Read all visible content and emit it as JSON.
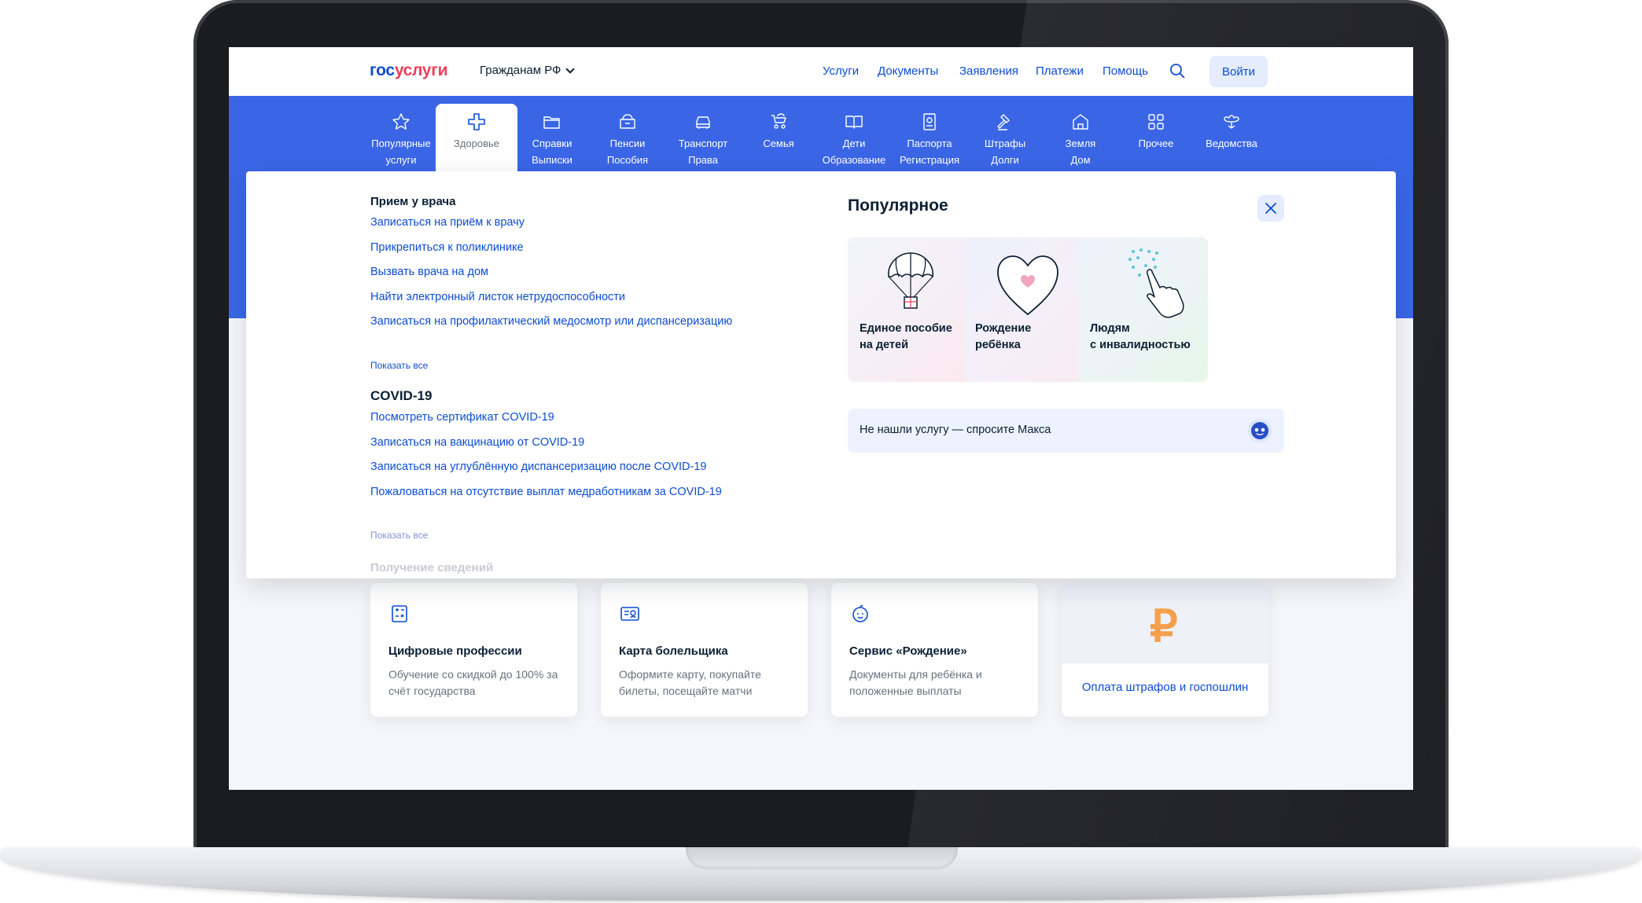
{
  "header": {
    "logo_part1": "гос",
    "logo_part2": "услуги",
    "region": "Гражданам РФ",
    "nav": [
      "Услуги",
      "Документы",
      "Заявления",
      "Платежи",
      "Помощь"
    ],
    "login": "Войти"
  },
  "categories": [
    {
      "l1": "Популярные",
      "l2": "услуги",
      "icon": "star-icon"
    },
    {
      "l1": "Здоровье",
      "l2": "",
      "icon": "medical-cross-icon"
    },
    {
      "l1": "Справки",
      "l2": "Выписки",
      "icon": "folder-icon"
    },
    {
      "l1": "Пенсии",
      "l2": "Пособия",
      "icon": "wallet-icon"
    },
    {
      "l1": "Транспорт",
      "l2": "Права",
      "icon": "car-icon"
    },
    {
      "l1": "Семья",
      "l2": "",
      "icon": "stroller-icon"
    },
    {
      "l1": "Дети",
      "l2": "Образование",
      "icon": "book-icon"
    },
    {
      "l1": "Паспорта",
      "l2": "Регистрация",
      "icon": "passport-icon"
    },
    {
      "l1": "Штрафы",
      "l2": "Долги",
      "icon": "gavel-icon"
    },
    {
      "l1": "Земля",
      "l2": "Дом",
      "icon": "house-icon"
    },
    {
      "l1": "Прочее",
      "l2": "",
      "icon": "grid-icon"
    },
    {
      "l1": "Ведомства",
      "l2": "",
      "icon": "emblem-icon"
    }
  ],
  "dropdown": {
    "sections": [
      {
        "title": "Прием у врача",
        "links": [
          "Записаться на приём к врачу",
          "Прикрепиться к поликлинике",
          "Вызвать врача на дом",
          "Найти электронный листок нетрудоспособности",
          "Записаться на профилактический медосмотр или диспансеризацию"
        ],
        "show_all": "Показать все"
      },
      {
        "title": "COVID-19",
        "links": [
          "Посмотреть сертификат COVID-19",
          "Записаться на вакцинацию от COVID-19",
          "Записаться на углублённую диспансеризацию после COVID-19",
          "Пожаловаться на отсутствие выплат медработникам за COVID-19"
        ],
        "show_all": "Показать все"
      }
    ],
    "next_section": "Получение сведений",
    "popular_title": "Популярное",
    "popular": [
      {
        "line1": "Единое пособие",
        "line2": "на детей",
        "art": "parachute-gift-icon"
      },
      {
        "line1": "Рождение",
        "line2": "ребёнка",
        "art": "heart-icon"
      },
      {
        "line1": "Людям",
        "line2": "с инвалидностью",
        "art": "braille-hand-icon"
      }
    ],
    "ask": "Не нашли услугу — спросите Макса"
  },
  "cards": [
    {
      "title": "Цифровые профессии",
      "desc": "Обучение со скидкой до 100% за счёт государства",
      "icon": "calculator-icon"
    },
    {
      "title": "Карта болельщика",
      "desc": "Оформите карту, покупайте билеты, посещайте матчи",
      "icon": "fan-card-icon"
    },
    {
      "title": "Сервис «Рождение»",
      "desc": "Документы для ребёнка и положенные выплаты",
      "icon": "baby-face-icon"
    }
  ],
  "pay_card": {
    "symbol": "₽",
    "link": "Оплата штрафов и госпошлин"
  },
  "colors": {
    "brand_blue": "#0d4cd3",
    "band_blue": "#3a66e6",
    "logo_red": "#ee3f58",
    "ruble_orange": "#f5a04c"
  }
}
